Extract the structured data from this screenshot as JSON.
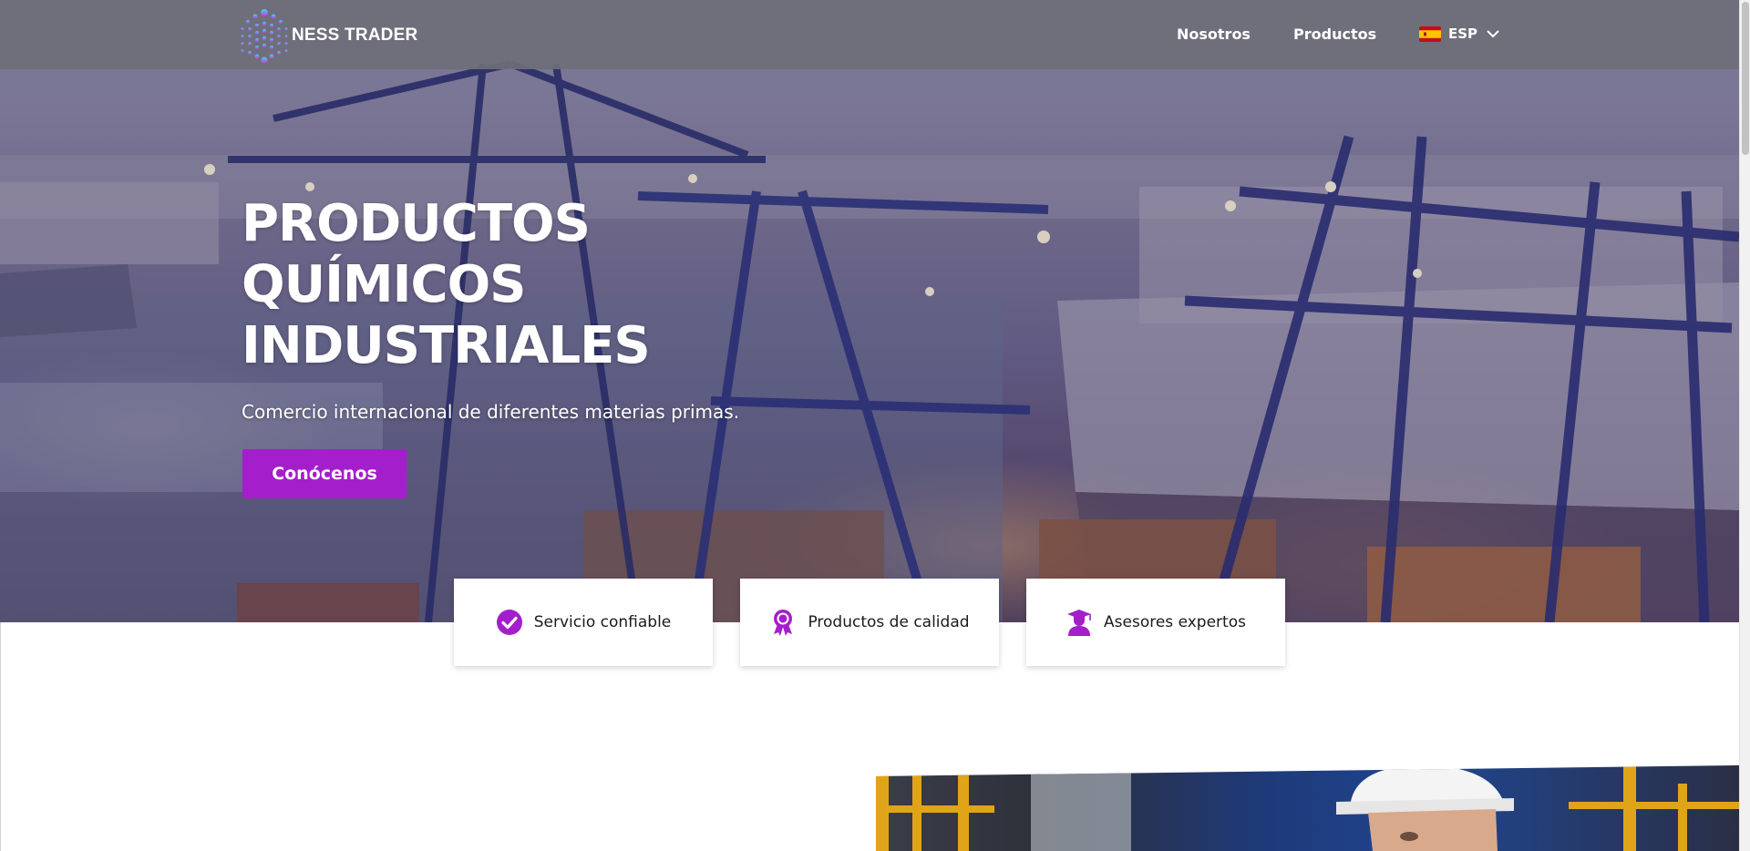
{
  "brand": {
    "name": "NESS TRADER",
    "accent_color": "#a51ecb"
  },
  "nav": {
    "items": [
      {
        "label": "Nosotros"
      },
      {
        "label": "Productos"
      }
    ],
    "language": {
      "label": "ESP",
      "flag_icon": "spain-flag-icon"
    }
  },
  "hero": {
    "title_lines": [
      "PRODUCTOS",
      "QUÍMICOS",
      "INDUSTRIALES"
    ],
    "subtitle": "Comercio internacional de diferentes materias primas.",
    "cta_label": "Conócenos",
    "background_description_icon": "port-cranes-image"
  },
  "features": [
    {
      "label": "Servicio confiable",
      "icon": "check-circle-icon"
    },
    {
      "label": "Productos de calidad",
      "icon": "award-ribbon-icon"
    },
    {
      "label": "Asesores expertos",
      "icon": "graduate-icon"
    }
  ]
}
